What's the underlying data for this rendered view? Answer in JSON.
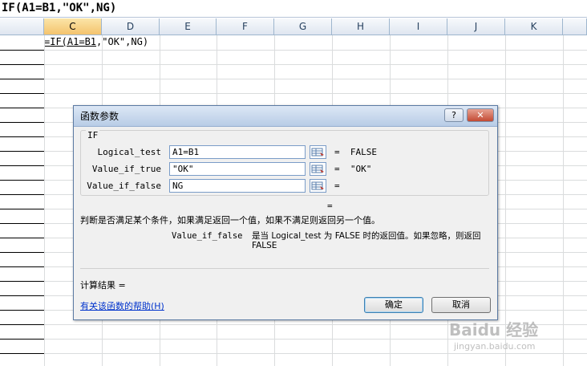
{
  "formula_bar": {
    "text": "IF(A1=B1,\"OK\",NG)"
  },
  "sheet": {
    "columns": [
      "C",
      "D",
      "E",
      "F",
      "G",
      "H",
      "I",
      "J",
      "K"
    ],
    "selected_column": "C",
    "cell_edit": {
      "prefix": "=IF(A1=B1",
      "suffix": ",\"OK\",NG)"
    }
  },
  "dialog": {
    "title": "函数参数",
    "help_button": "?",
    "close_button": "✕",
    "function_name": "IF",
    "args": [
      {
        "label": "Logical_test",
        "value": "A1=B1",
        "result": "=  FALSE"
      },
      {
        "label": "Value_if_true",
        "value": "\"OK\"",
        "result": "=  \"OK\""
      },
      {
        "label": "Value_if_false",
        "value": "NG",
        "result": "="
      }
    ],
    "formula_result": "=",
    "description": "判断是否满足某个条件，如果满足返回一个值，如果不满足则返回另一个值。",
    "arg_description_name": "Value_if_false",
    "arg_description_text": "是当 Logical_test 为 FALSE 时的返回值。如果忽略，则返回 FALSE",
    "calc_result_label": "计算结果 =",
    "help_link": "有关该函数的帮助(H)",
    "ok_button": "确定",
    "cancel_button": "取消"
  },
  "watermark": {
    "main": "Baidu 经验",
    "sub": "jingyan.baidu.com"
  },
  "colors": {
    "link": "#0033cc",
    "header_selected": "#f4c36d",
    "dialog_bg": "#f0f0f0"
  }
}
